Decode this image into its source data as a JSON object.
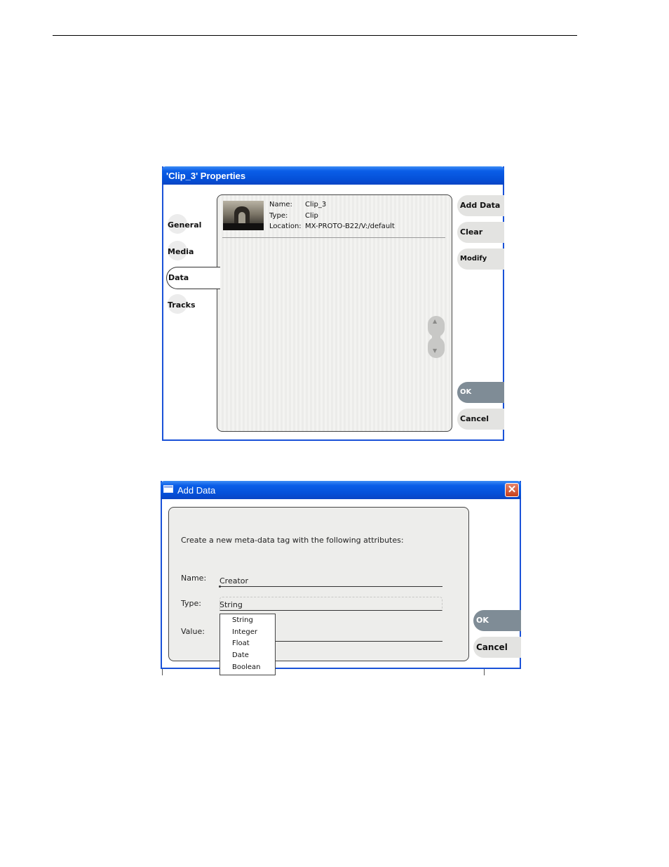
{
  "properties_window": {
    "title": "'Clip_3' Properties",
    "tabs": [
      "General",
      "Media",
      "Data",
      "Tracks"
    ],
    "active_tab": "Data",
    "clip_info": {
      "name_label": "Name:",
      "name_value": "Clip_3",
      "type_label": "Type:",
      "type_value": "Clip",
      "location_label": "Location:",
      "location_value": "MX-PROTO-B22/V:/default"
    },
    "buttons": {
      "add_data": "Add Data",
      "clear": "Clear",
      "modify": "Modify",
      "ok": "OK",
      "cancel": "Cancel"
    },
    "scroll_up_icon": "chevron-up-icon",
    "scroll_down_icon": "chevron-down-icon"
  },
  "add_data_dialog": {
    "title": "Add Data",
    "close_icon": "close-icon",
    "prompt": "Create a new meta-data tag with the following attributes:",
    "name_label": "Name:",
    "name_value": "Creator",
    "type_label": "Type:",
    "type_value": "String",
    "value_label": "Value:",
    "value_value": "",
    "type_options": [
      "String",
      "Integer",
      "Float",
      "Date",
      "Boolean"
    ],
    "buttons": {
      "ok": "OK",
      "cancel": "Cancel"
    }
  },
  "colors": {
    "titlebar_blue": "#0550d8",
    "window_border": "#1a52d8",
    "ok_button": "#7f8c96",
    "panel_gray": "#ededeb",
    "close_red": "#c8401c"
  }
}
